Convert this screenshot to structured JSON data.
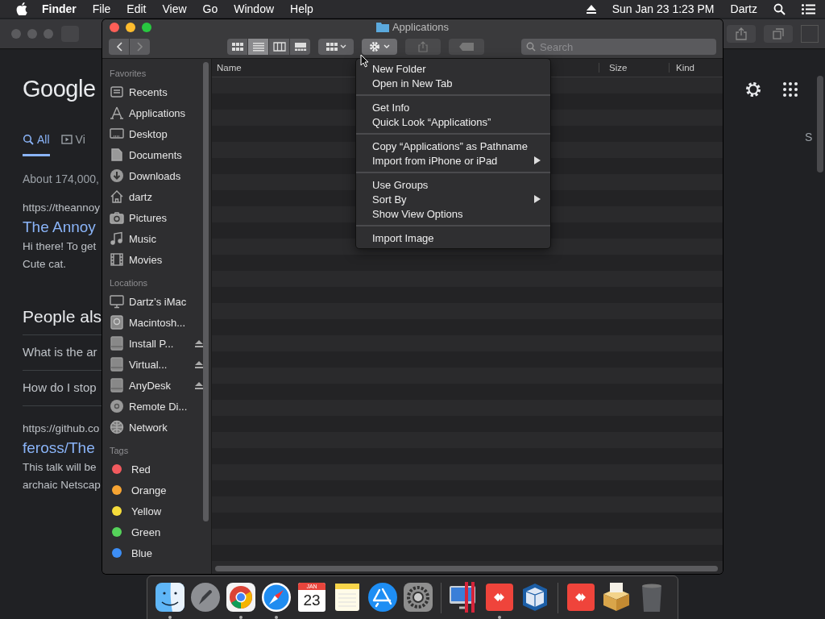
{
  "menubar": {
    "app": "Finder",
    "items": [
      "File",
      "Edit",
      "View",
      "Go",
      "Window",
      "Help"
    ],
    "clock": "Sun Jan 23  1:23 PM",
    "user": "Dartz"
  },
  "browser": {
    "logo": "Google",
    "tabs": [
      {
        "label": "All",
        "selected": true
      },
      {
        "label": "Vi",
        "selected": false
      }
    ],
    "right_tab": "S",
    "result_count": "About 174,000,",
    "results": [
      {
        "kind": "url",
        "text": "https://theannoy"
      },
      {
        "kind": "title",
        "text": "The Annoy"
      },
      {
        "kind": "snippet",
        "text": "Hi there! To get"
      },
      {
        "kind": "snippet",
        "text": "Cute cat."
      },
      {
        "kind": "heading",
        "text": "People als"
      },
      {
        "kind": "question",
        "text": "What is the ar"
      },
      {
        "kind": "question",
        "text": "How do I stop"
      },
      {
        "kind": "url",
        "text": "https://github.co"
      },
      {
        "kind": "title",
        "text": "feross/The"
      },
      {
        "kind": "snippet",
        "text": "This talk will be"
      },
      {
        "kind": "snippet",
        "text": "archaic Netscap"
      }
    ]
  },
  "finder": {
    "title": "Applications",
    "search": {
      "placeholder": "Search"
    },
    "view_buttons": [
      {
        "kind": "icons",
        "selected": false
      },
      {
        "kind": "list",
        "selected": true
      },
      {
        "kind": "columns",
        "selected": false
      },
      {
        "kind": "gallery",
        "selected": false
      }
    ],
    "sidebar": [
      {
        "heading": "Favorites",
        "items": [
          {
            "kind": "recents",
            "label": "Recents"
          },
          {
            "kind": "apps",
            "label": "Applications"
          },
          {
            "kind": "desktop",
            "label": "Desktop"
          },
          {
            "kind": "documents",
            "label": "Documents"
          },
          {
            "kind": "downloads",
            "label": "Downloads"
          },
          {
            "kind": "home",
            "label": "dartz"
          },
          {
            "kind": "pictures",
            "label": "Pictures"
          },
          {
            "kind": "music",
            "label": "Music"
          },
          {
            "kind": "movies",
            "label": "Movies"
          }
        ]
      },
      {
        "heading": "Locations",
        "items": [
          {
            "kind": "computer",
            "label": "Dartz’s iMac"
          },
          {
            "kind": "disk",
            "label": "Macintosh..."
          },
          {
            "kind": "drive",
            "label": "Install P...",
            "eject": true
          },
          {
            "kind": "drive",
            "label": "Virtual...",
            "eject": true
          },
          {
            "kind": "drive",
            "label": "AnyDesk",
            "eject": true
          },
          {
            "kind": "disc",
            "label": "Remote Di..."
          },
          {
            "kind": "network",
            "label": "Network"
          }
        ]
      },
      {
        "heading": "Tags",
        "items": [
          {
            "kind": "tag",
            "label": "Red",
            "color": "#f25a5e"
          },
          {
            "kind": "tag",
            "label": "Orange",
            "color": "#f7a533"
          },
          {
            "kind": "tag",
            "label": "Yellow",
            "color": "#f5dc3b"
          },
          {
            "kind": "tag",
            "label": "Green",
            "color": "#55d25a"
          },
          {
            "kind": "tag",
            "label": "Blue",
            "color": "#3d8ef5"
          }
        ]
      }
    ],
    "columns": [
      "Name",
      "Size",
      "Kind"
    ],
    "menu": [
      [
        {
          "label": "New Folder",
          "submenu": false
        },
        {
          "label": "Open in New Tab",
          "submenu": false
        }
      ],
      [
        {
          "label": "Get Info",
          "submenu": false
        },
        {
          "label": "Quick Look “Applications”",
          "submenu": false
        }
      ],
      [
        {
          "label": "Copy “Applications” as Pathname",
          "submenu": false
        },
        {
          "label": "Import from iPhone or iPad",
          "submenu": true
        }
      ],
      [
        {
          "label": "Use Groups",
          "submenu": false
        },
        {
          "label": "Sort By",
          "submenu": true
        },
        {
          "label": "Show View Options",
          "submenu": false
        }
      ],
      [
        {
          "label": "Import Image",
          "submenu": false
        }
      ]
    ]
  },
  "dock": [
    {
      "kind": "finder",
      "running": true
    },
    {
      "kind": "launchpad",
      "running": false
    },
    {
      "kind": "chrome",
      "running": true
    },
    {
      "kind": "safari",
      "running": true
    },
    {
      "kind": "calendar",
      "running": false,
      "month": "JAN",
      "day": "23"
    },
    {
      "kind": "notes",
      "running": false
    },
    {
      "kind": "appstore",
      "running": false
    },
    {
      "kind": "settings",
      "running": false
    },
    {
      "kind": "separator"
    },
    {
      "kind": "parallels",
      "running": false
    },
    {
      "kind": "anydesk",
      "running": true
    },
    {
      "kind": "virtualbox",
      "running": false
    },
    {
      "kind": "separator"
    },
    {
      "kind": "anydesk",
      "running": false
    },
    {
      "kind": "installer",
      "running": false
    },
    {
      "kind": "trash",
      "running": false
    }
  ]
}
